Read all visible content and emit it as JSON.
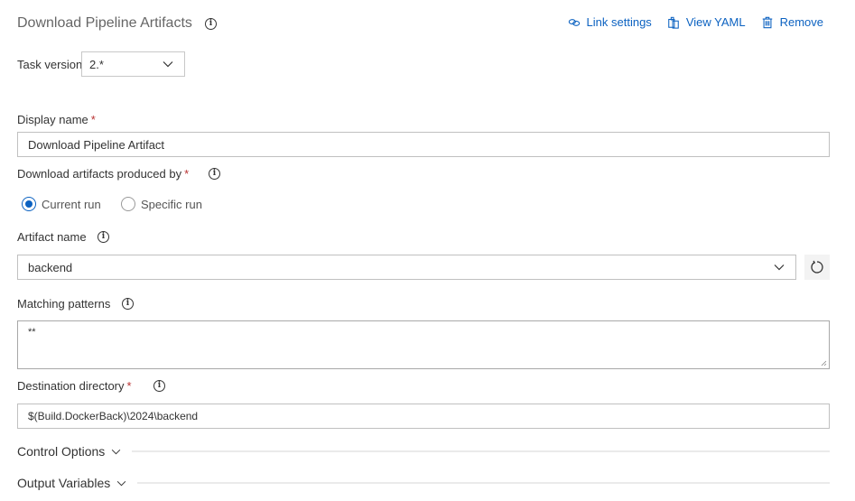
{
  "header": {
    "title": "Download Pipeline Artifacts",
    "actions": [
      {
        "label": "Link settings",
        "icon": "link-icon"
      },
      {
        "label": "View YAML",
        "icon": "clipboard-icon"
      },
      {
        "label": "Remove",
        "icon": "trash-icon"
      }
    ]
  },
  "task_version": {
    "label": "Task version",
    "value": "2.*"
  },
  "display_name": {
    "label": "Display name",
    "required": "*",
    "value": "Download Pipeline Artifact"
  },
  "produced_by": {
    "label": "Download artifacts produced by",
    "required": "*",
    "options": [
      {
        "label": "Current run",
        "selected": true
      },
      {
        "label": "Specific run",
        "selected": false
      }
    ]
  },
  "artifact_name": {
    "label": "Artifact name",
    "value": "backend"
  },
  "matching_patterns": {
    "label": "Matching patterns",
    "value": "**"
  },
  "destination_directory": {
    "label": "Destination directory",
    "required": "*",
    "value": "$(Build.DockerBack)\\2024\\backend"
  },
  "sections": [
    {
      "label": "Control Options"
    },
    {
      "label": "Output Variables"
    }
  ],
  "colors": {
    "accent": "#0c62c1",
    "required": "#b83232"
  }
}
